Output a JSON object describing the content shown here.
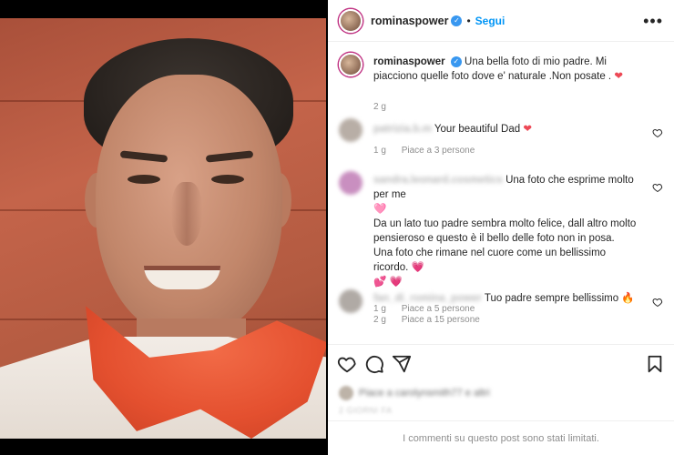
{
  "post": {
    "username": "rominaspower",
    "follow_label": "Segui",
    "more_label": "•••",
    "caption_text": "Una bella foto di mio padre. Mi piacciono quelle foto dove e' naturale .Non posate . ",
    "caption_emoji": "❤",
    "caption_age": "2 g"
  },
  "comments": [
    {
      "author": "patrizia.b.m",
      "text": "Your beautiful Dad ",
      "emoji": "❤",
      "age": "1 g",
      "likes": "Piace a 3 persone"
    },
    {
      "author": "sandra.leonard.cosmetics",
      "text_line1": "Una foto che esprime molto per me",
      "emoji1": "🩷",
      "text_rest1": "Da un lato tuo padre sembra molto felice, dall altro molto pensieroso e questo è il bello delle foto non in posa.",
      "text_rest2": "Una foto che rimane nel cuore come un bellissimo ricordo. ",
      "emoji2": "💗",
      "emoji3": "💕 💗",
      "age": "1 g",
      "likes": "Piace a 5 persone"
    },
    {
      "author": "fan_di_romina_power",
      "text": "Tuo padre sempre bellissimo ",
      "emoji": "🔥",
      "age": "2 g",
      "likes": "Piace a 15 persone"
    }
  ],
  "likes_summary": "Piace a carolynsmith77 e altri",
  "post_date": "2 GIORNI FA",
  "limited_notice": "I commenti su questo post sono stati limitati.",
  "icons": {
    "verified": "✓",
    "like": "heart-icon",
    "comment": "comment-icon",
    "share": "share-icon",
    "save": "bookmark-icon"
  },
  "colors": {
    "accent": "#0095f6",
    "verified": "#3897f0",
    "heart": "#ed4956"
  }
}
